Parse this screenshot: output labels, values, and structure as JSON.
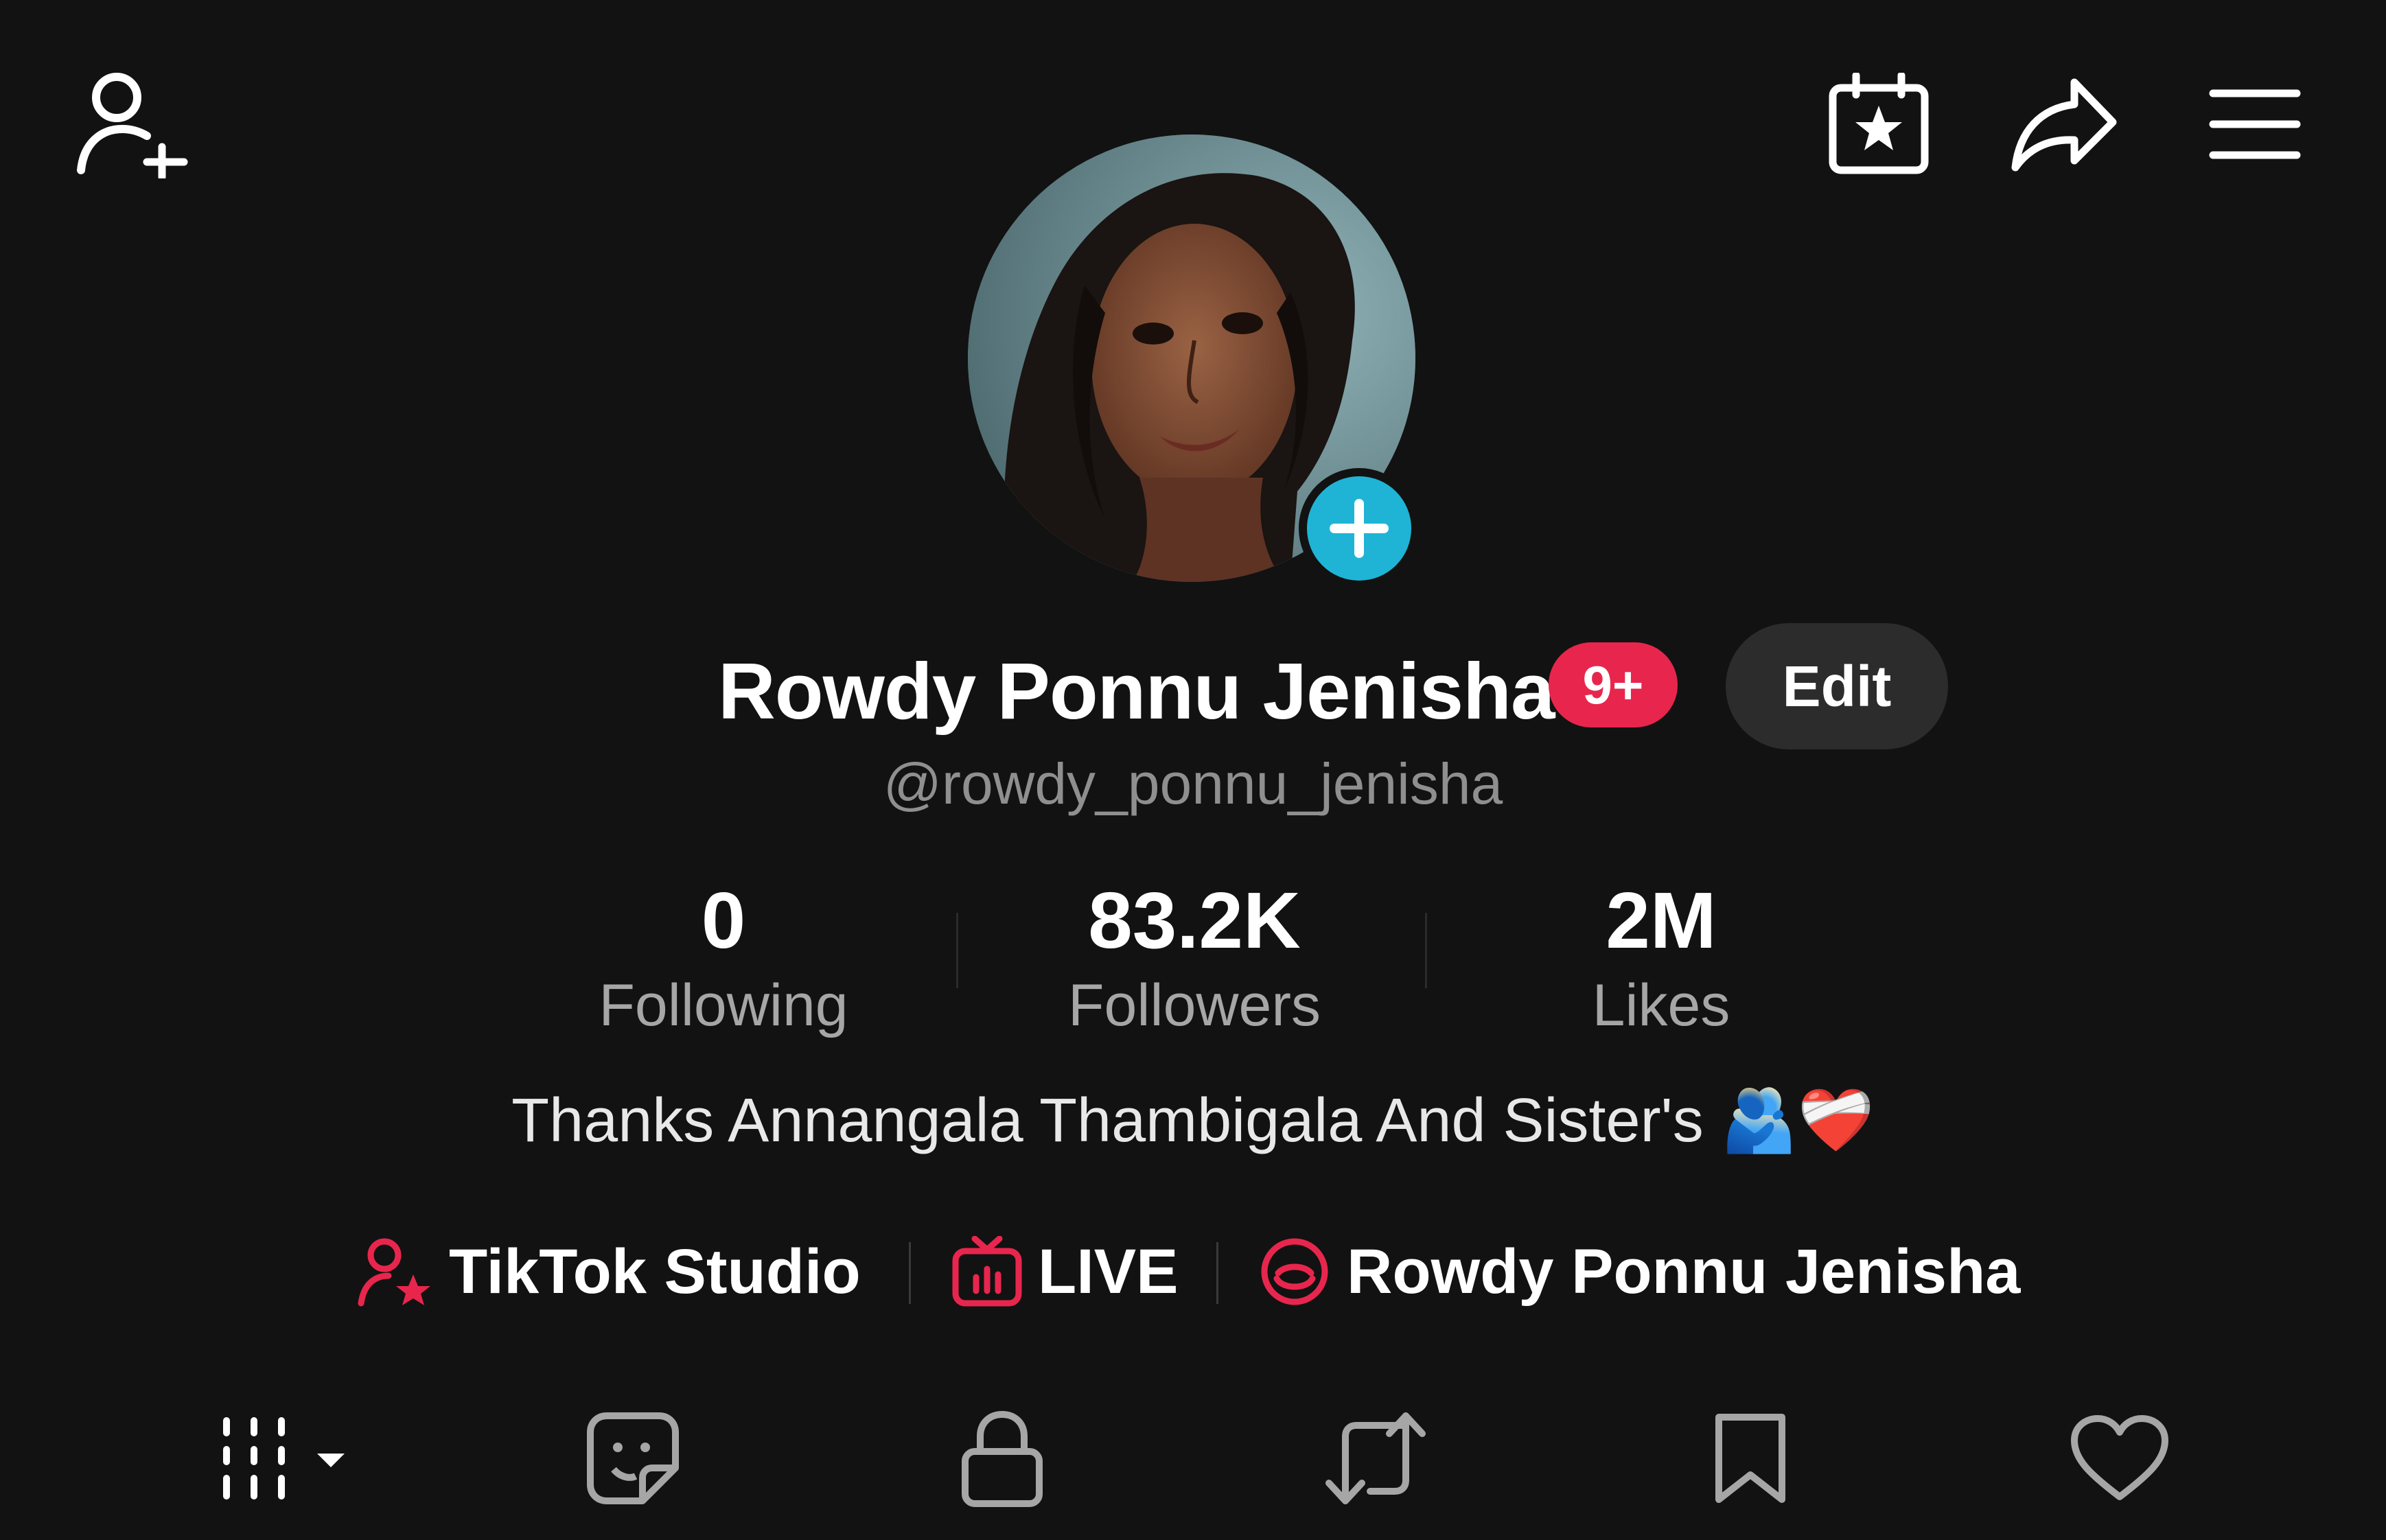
{
  "header": {
    "add_friend_icon": "person-add-icon",
    "calendar_icon": "calendar-star-icon",
    "share_icon": "share-arrow-icon",
    "menu_icon": "hamburger-menu-icon"
  },
  "profile": {
    "display_name": "Rowdy Ponnu Jenisha",
    "notification_badge": "9+",
    "edit_label": "Edit",
    "handle": "@rowdy_ponnu_jenisha"
  },
  "stats": {
    "following": {
      "value": "0",
      "label": "Following"
    },
    "followers": {
      "value": "83.2K",
      "label": "Followers"
    },
    "likes": {
      "value": "2M",
      "label": "Likes"
    }
  },
  "bio": {
    "text": "Thanks Annangala Thambigala And Sister's 🫂❤️‍🩹"
  },
  "links": {
    "studio": "TikTok Studio",
    "live": "LIVE",
    "group": "Rowdy Ponnu Jenisha"
  },
  "tabs": [
    "videos-grid-icon",
    "sticker-icon",
    "lock-icon",
    "repost-icon",
    "bookmark-icon",
    "heart-icon"
  ],
  "colors": {
    "background": "#121212",
    "accent_pink": "#e8264d",
    "avatar_add": "#1fb4d6",
    "muted_text": "#a6a6a6"
  }
}
